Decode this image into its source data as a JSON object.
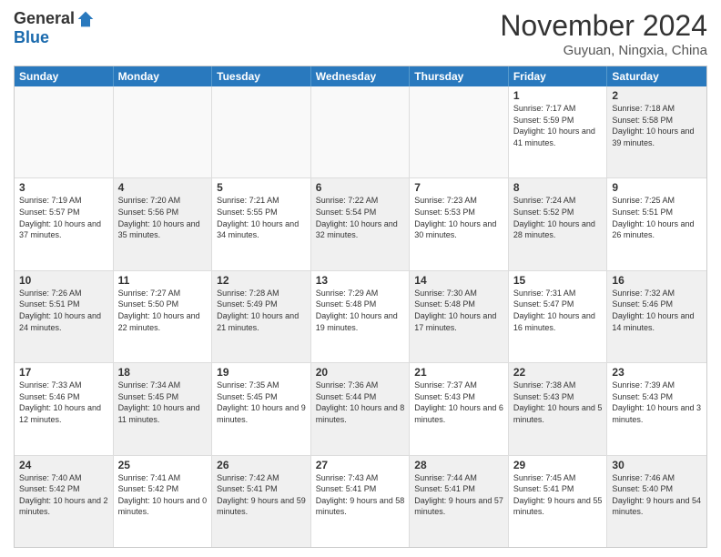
{
  "header": {
    "logo_general": "General",
    "logo_blue": "Blue",
    "month_title": "November 2024",
    "location": "Guyuan, Ningxia, China"
  },
  "calendar": {
    "days": [
      "Sunday",
      "Monday",
      "Tuesday",
      "Wednesday",
      "Thursday",
      "Friday",
      "Saturday"
    ],
    "rows": [
      [
        {
          "day": "",
          "info": "",
          "empty": true
        },
        {
          "day": "",
          "info": "",
          "empty": true
        },
        {
          "day": "",
          "info": "",
          "empty": true
        },
        {
          "day": "",
          "info": "",
          "empty": true
        },
        {
          "day": "",
          "info": "",
          "empty": true
        },
        {
          "day": "1",
          "info": "Sunrise: 7:17 AM\nSunset: 5:59 PM\nDaylight: 10 hours and 41 minutes."
        },
        {
          "day": "2",
          "info": "Sunrise: 7:18 AM\nSunset: 5:58 PM\nDaylight: 10 hours and 39 minutes.",
          "shaded": true
        }
      ],
      [
        {
          "day": "3",
          "info": "Sunrise: 7:19 AM\nSunset: 5:57 PM\nDaylight: 10 hours and 37 minutes."
        },
        {
          "day": "4",
          "info": "Sunrise: 7:20 AM\nSunset: 5:56 PM\nDaylight: 10 hours and 35 minutes.",
          "shaded": true
        },
        {
          "day": "5",
          "info": "Sunrise: 7:21 AM\nSunset: 5:55 PM\nDaylight: 10 hours and 34 minutes."
        },
        {
          "day": "6",
          "info": "Sunrise: 7:22 AM\nSunset: 5:54 PM\nDaylight: 10 hours and 32 minutes.",
          "shaded": true
        },
        {
          "day": "7",
          "info": "Sunrise: 7:23 AM\nSunset: 5:53 PM\nDaylight: 10 hours and 30 minutes."
        },
        {
          "day": "8",
          "info": "Sunrise: 7:24 AM\nSunset: 5:52 PM\nDaylight: 10 hours and 28 minutes.",
          "shaded": true
        },
        {
          "day": "9",
          "info": "Sunrise: 7:25 AM\nSunset: 5:51 PM\nDaylight: 10 hours and 26 minutes."
        }
      ],
      [
        {
          "day": "10",
          "info": "Sunrise: 7:26 AM\nSunset: 5:51 PM\nDaylight: 10 hours and 24 minutes.",
          "shaded": true
        },
        {
          "day": "11",
          "info": "Sunrise: 7:27 AM\nSunset: 5:50 PM\nDaylight: 10 hours and 22 minutes."
        },
        {
          "day": "12",
          "info": "Sunrise: 7:28 AM\nSunset: 5:49 PM\nDaylight: 10 hours and 21 minutes.",
          "shaded": true
        },
        {
          "day": "13",
          "info": "Sunrise: 7:29 AM\nSunset: 5:48 PM\nDaylight: 10 hours and 19 minutes."
        },
        {
          "day": "14",
          "info": "Sunrise: 7:30 AM\nSunset: 5:48 PM\nDaylight: 10 hours and 17 minutes.",
          "shaded": true
        },
        {
          "day": "15",
          "info": "Sunrise: 7:31 AM\nSunset: 5:47 PM\nDaylight: 10 hours and 16 minutes."
        },
        {
          "day": "16",
          "info": "Sunrise: 7:32 AM\nSunset: 5:46 PM\nDaylight: 10 hours and 14 minutes.",
          "shaded": true
        }
      ],
      [
        {
          "day": "17",
          "info": "Sunrise: 7:33 AM\nSunset: 5:46 PM\nDaylight: 10 hours and 12 minutes."
        },
        {
          "day": "18",
          "info": "Sunrise: 7:34 AM\nSunset: 5:45 PM\nDaylight: 10 hours and 11 minutes.",
          "shaded": true
        },
        {
          "day": "19",
          "info": "Sunrise: 7:35 AM\nSunset: 5:45 PM\nDaylight: 10 hours and 9 minutes."
        },
        {
          "day": "20",
          "info": "Sunrise: 7:36 AM\nSunset: 5:44 PM\nDaylight: 10 hours and 8 minutes.",
          "shaded": true
        },
        {
          "day": "21",
          "info": "Sunrise: 7:37 AM\nSunset: 5:43 PM\nDaylight: 10 hours and 6 minutes."
        },
        {
          "day": "22",
          "info": "Sunrise: 7:38 AM\nSunset: 5:43 PM\nDaylight: 10 hours and 5 minutes.",
          "shaded": true
        },
        {
          "day": "23",
          "info": "Sunrise: 7:39 AM\nSunset: 5:43 PM\nDaylight: 10 hours and 3 minutes."
        }
      ],
      [
        {
          "day": "24",
          "info": "Sunrise: 7:40 AM\nSunset: 5:42 PM\nDaylight: 10 hours and 2 minutes.",
          "shaded": true
        },
        {
          "day": "25",
          "info": "Sunrise: 7:41 AM\nSunset: 5:42 PM\nDaylight: 10 hours and 0 minutes."
        },
        {
          "day": "26",
          "info": "Sunrise: 7:42 AM\nSunset: 5:41 PM\nDaylight: 9 hours and 59 minutes.",
          "shaded": true
        },
        {
          "day": "27",
          "info": "Sunrise: 7:43 AM\nSunset: 5:41 PM\nDaylight: 9 hours and 58 minutes."
        },
        {
          "day": "28",
          "info": "Sunrise: 7:44 AM\nSunset: 5:41 PM\nDaylight: 9 hours and 57 minutes.",
          "shaded": true
        },
        {
          "day": "29",
          "info": "Sunrise: 7:45 AM\nSunset: 5:41 PM\nDaylight: 9 hours and 55 minutes."
        },
        {
          "day": "30",
          "info": "Sunrise: 7:46 AM\nSunset: 5:40 PM\nDaylight: 9 hours and 54 minutes.",
          "shaded": true
        }
      ]
    ]
  }
}
